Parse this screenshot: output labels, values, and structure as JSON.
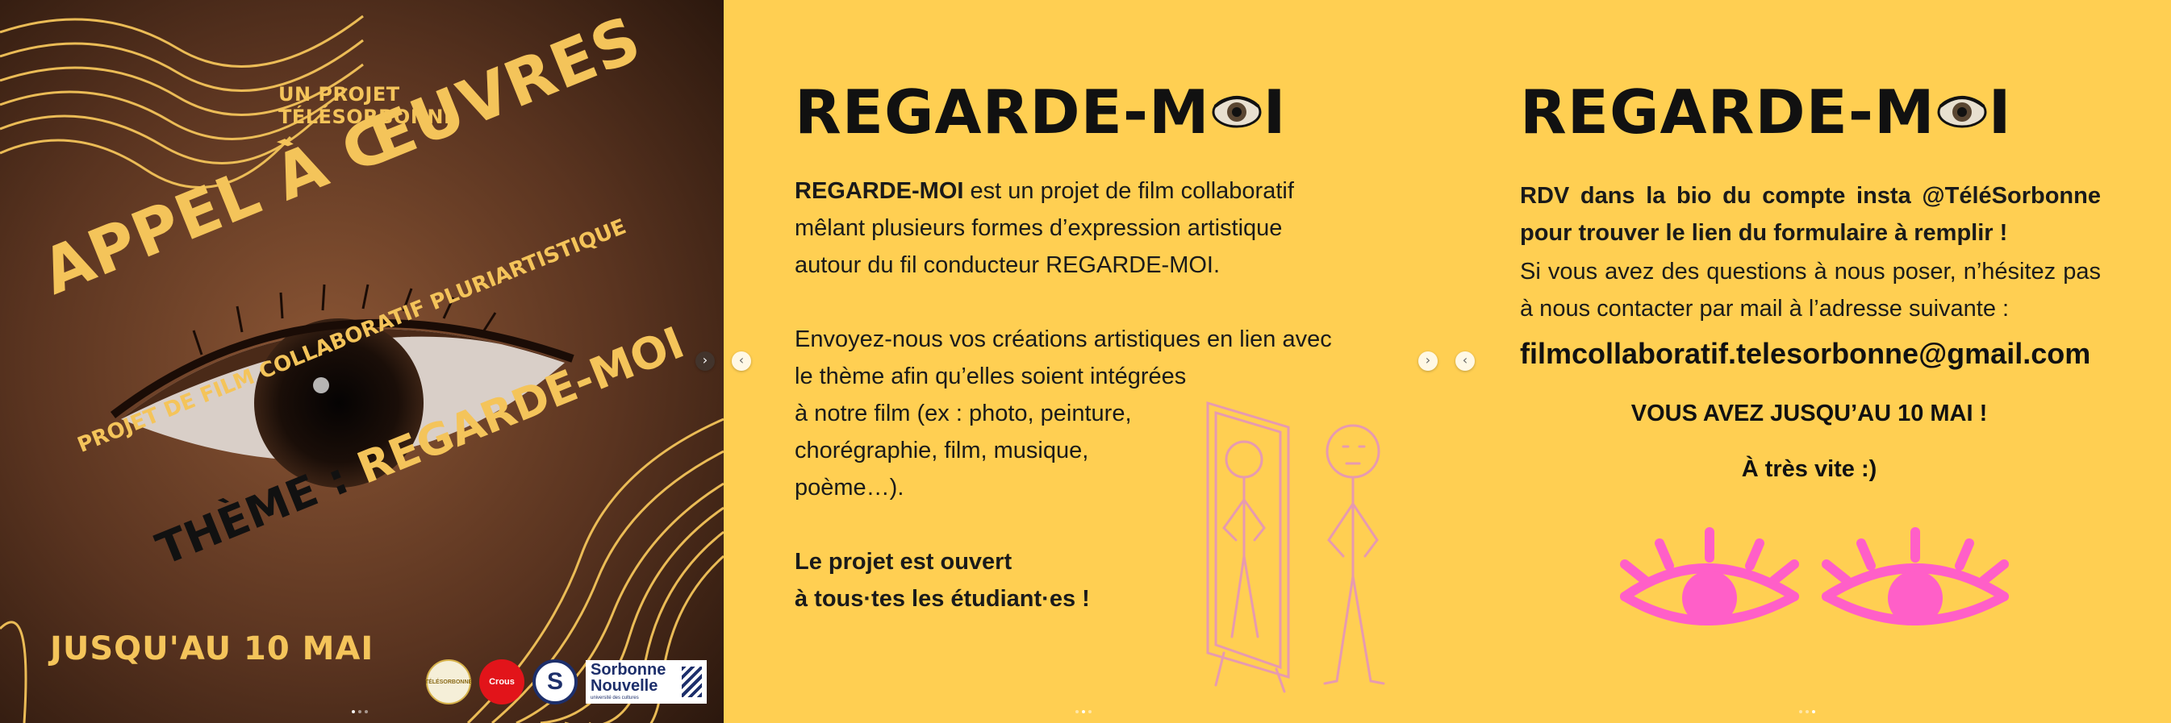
{
  "slide1": {
    "kicker": "UN PROJET TÉLÉSORBONNE",
    "title": "APPEL À ŒUVRES",
    "subtitle": "PROJET DE FILM COLLABORATIF PLURIARTISTIQUE",
    "theme_label": "THÈME :",
    "theme_value": "REGARDE-MOI",
    "deadline": "JUSQU'AU 10 MAI",
    "logos": {
      "telesorbonne": "TÉLÉSORBONNE",
      "crous": "Crous",
      "s_monogram": "S",
      "sorbonne_nouvelle": "Sorbonne Nouvelle",
      "sorbonne_nouvelle_tagline": "université des cultures"
    }
  },
  "brand": {
    "prefix": "REGARDE-M",
    "suffix": "I"
  },
  "slide2": {
    "intro_strong": "REGARDE-MOI",
    "intro_rest": " est un projet de film collaboratif mêlant plusieurs formes d’expression artistique autour du fil conducteur REGARDE-MOI.",
    "send_lines": [
      "Envoyez-nous vos créations artistiques en lien avec",
      "le thème afin qu’elles soient intégrées",
      "à notre film (ex : photo, peinture,",
      "chorégraphie, film, musique,",
      "poème…)."
    ],
    "open_line1": "Le projet est ouvert",
    "open_line2": "à tous·tes les étudiant·es !"
  },
  "slide3": {
    "rdv": "RDV dans la bio du compte insta @TéléSorbonne pour trouver le lien du formulaire à remplir !",
    "questions": "Si vous avez des questions à nous poser, n’hésitez pas à nous contacter par mail à l’adresse suivante :",
    "email": "filmcollaboratif.telesorbonne@gmail.com",
    "deadline": "VOUS AVEZ JUSQU’AU 10 MAI !",
    "bye": "À très vite :)"
  },
  "nav": {
    "next": "›",
    "prev": "‹"
  },
  "colors": {
    "yellow": "#ffcf52",
    "gold": "#f4c45a",
    "pink": "#ff5fc8",
    "sketch": "#e79ab0"
  }
}
